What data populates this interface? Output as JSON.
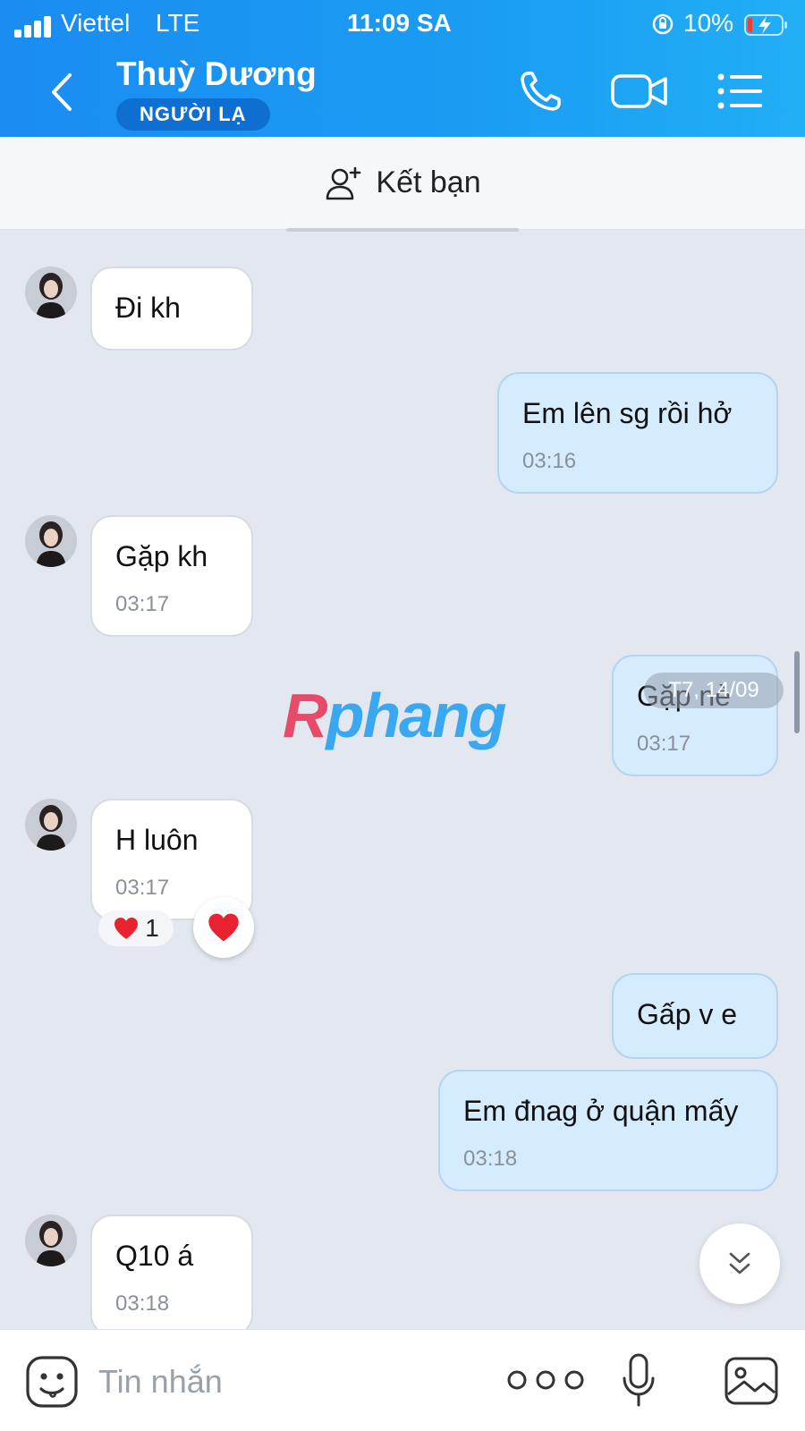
{
  "status_bar": {
    "carrier": "Viettel",
    "network": "LTE",
    "time": "11:09 SA",
    "battery": "10%"
  },
  "header": {
    "title": "Thuỳ Dương",
    "badge": "NGƯỜI LẠ",
    "icons": [
      "back-arrow-icon",
      "phone-icon",
      "video-call-icon",
      "menu-icon"
    ]
  },
  "add_friend": {
    "label": "Kết bạn"
  },
  "messages": [
    {
      "side": "in",
      "text": "Đi kh",
      "time": ""
    },
    {
      "side": "out",
      "text": "Em lên sg rồi hở",
      "time": "03:16"
    },
    {
      "side": "in",
      "text": "Gặp kh",
      "time": "03:17"
    },
    {
      "side": "out",
      "text": "Gặp nè",
      "time": "03:17"
    },
    {
      "side": "in",
      "text": "H luôn",
      "time": "03:17",
      "reaction": {
        "emoji": "❤",
        "count": "1"
      }
    },
    {
      "side": "out",
      "text": "Gấp v e",
      "time": ""
    },
    {
      "side": "out",
      "text": "Em đnag ở quận mấy",
      "time": "03:18"
    },
    {
      "side": "in",
      "text": "Q10 á",
      "time": "03:18"
    }
  ],
  "date_chip": "T7, 14/09",
  "watermark": {
    "part1": "R",
    "part2": "phang"
  },
  "composer": {
    "placeholder": "Tin nhắn"
  },
  "colors": {
    "header": "#1a8cf2",
    "outgoing_bubble": "#d4ecfd",
    "incoming_bubble": "#ffffff",
    "background": "#e2e7f0"
  }
}
